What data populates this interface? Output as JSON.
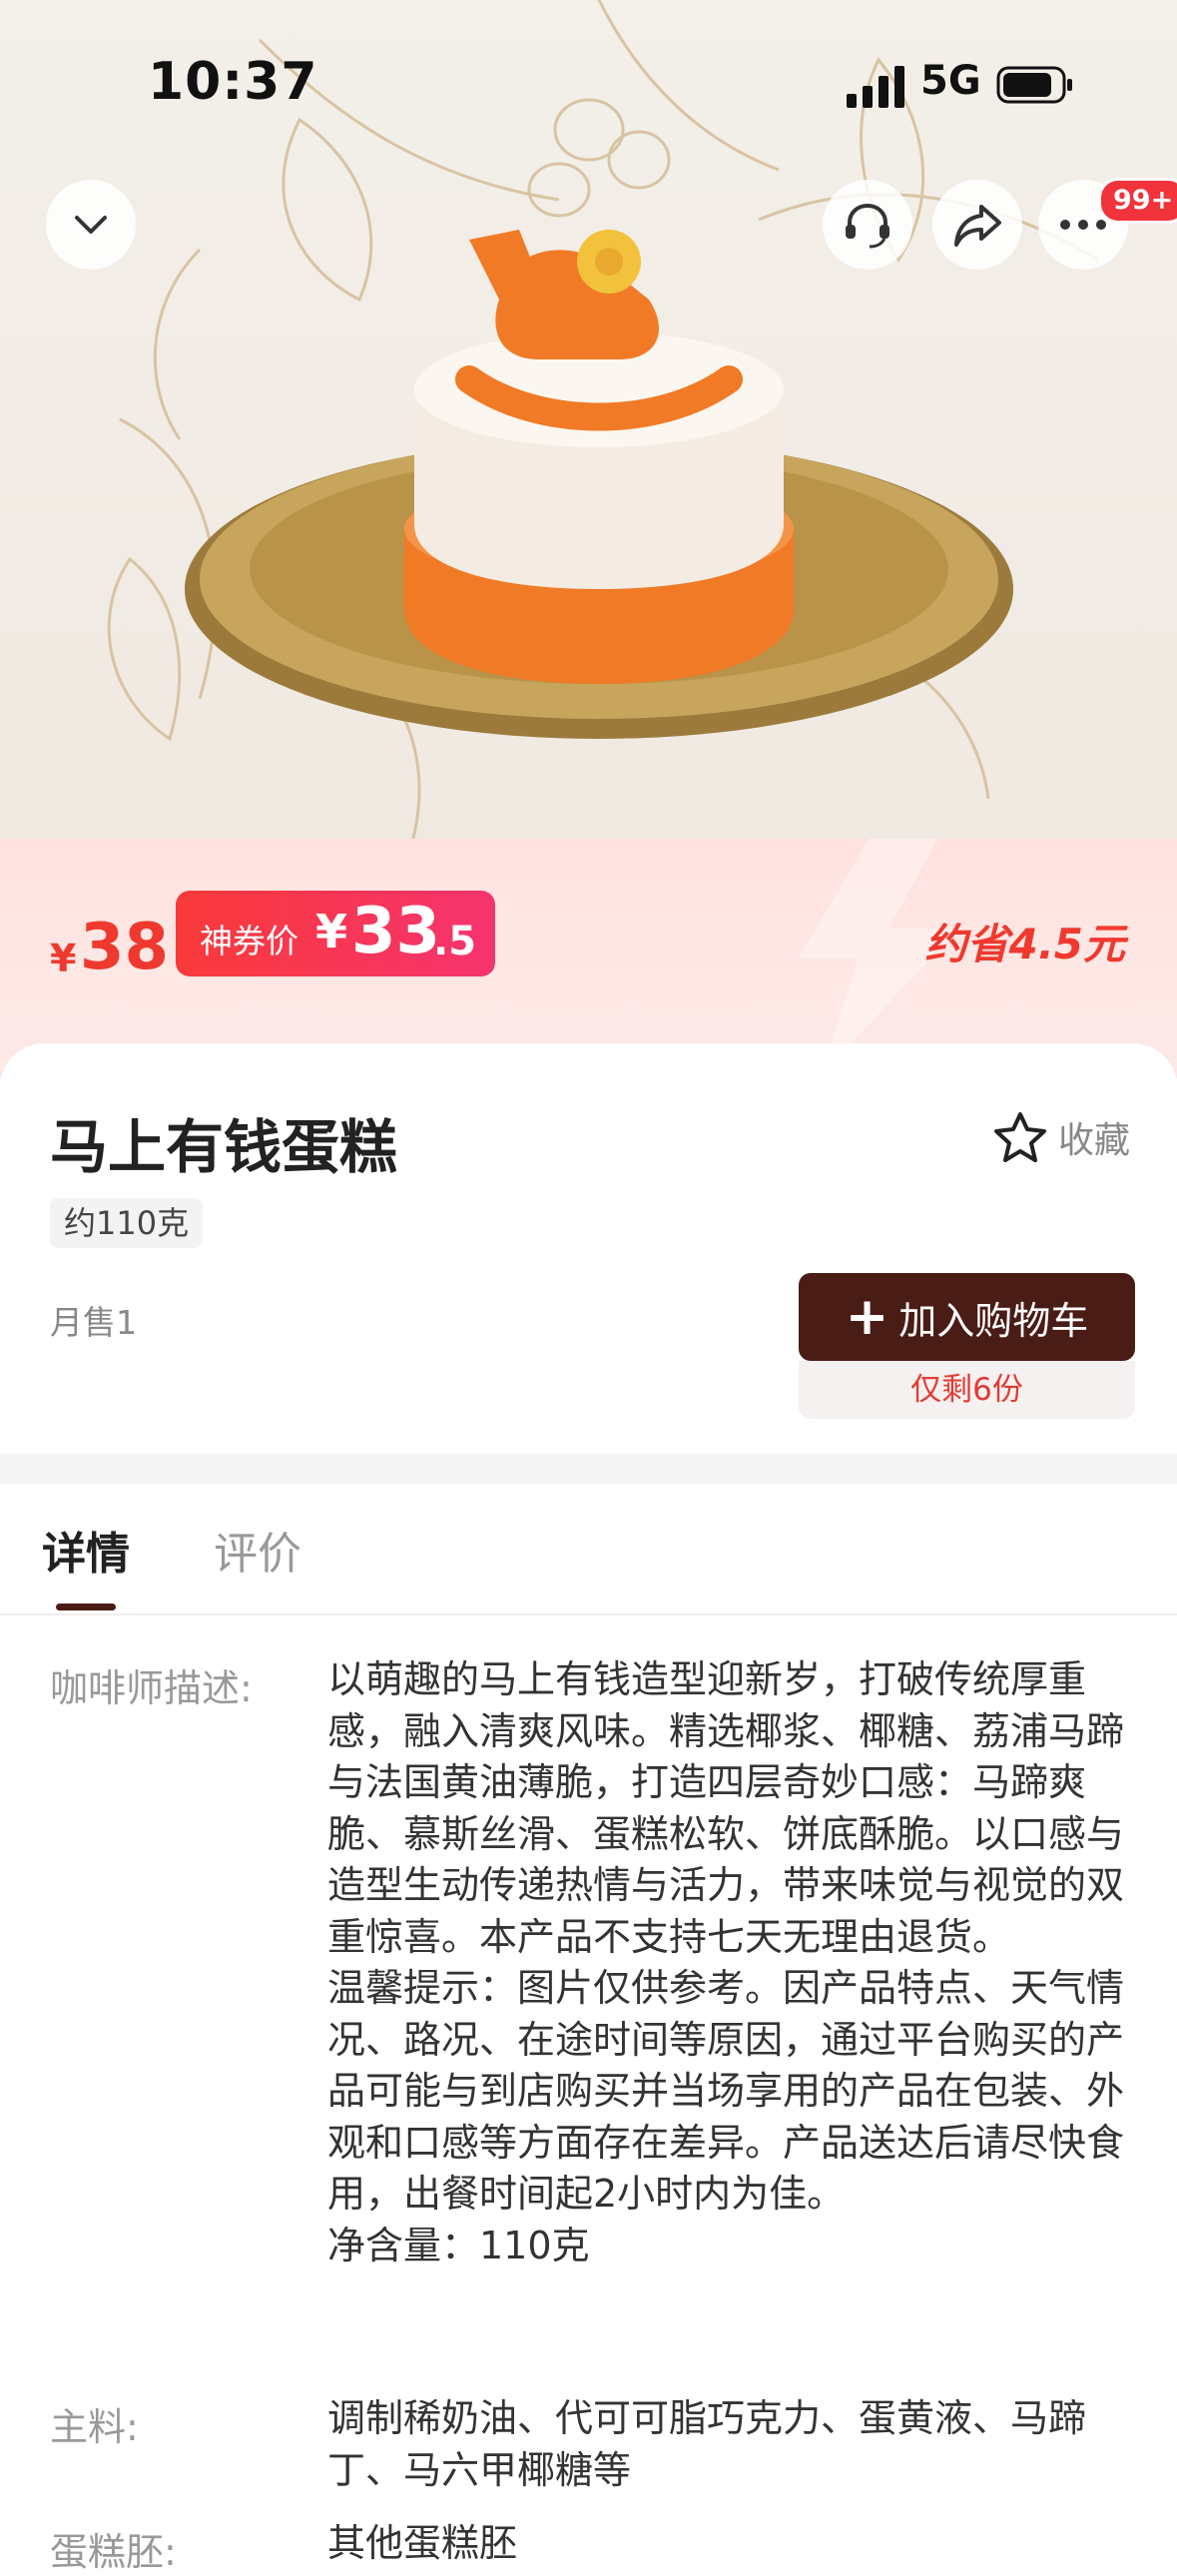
{
  "status_bar": {
    "time": "10:37",
    "network": "5G"
  },
  "top_nav": {
    "badge": "99+"
  },
  "price": {
    "currency": "¥",
    "original": "38",
    "coupon_label": "神券价",
    "coupon_currency": "¥",
    "coupon_int": "33",
    "coupon_dec": ".5",
    "savings": "约省4.5元"
  },
  "product": {
    "name": "马上有钱蛋糕",
    "favorite_label": "收藏",
    "weight": "约110克",
    "monthly_sales": "月售1",
    "add_to_cart": "加入购物车",
    "stock": "仅剩6份"
  },
  "tabs": [
    {
      "label": "详情"
    },
    {
      "label": "评价"
    }
  ],
  "details": [
    {
      "label": "咖啡师描述:",
      "value": "以萌趣的马上有钱造型迎新岁，打破传统厚重感，融入清爽风味。精选椰浆、椰糖、荔浦马蹄与法国黄油薄脆，打造四层奇妙口感：马蹄爽脆、慕斯丝滑、蛋糕松软、饼底酥脆。以口感与造型生动传递热情与活力，带来味觉与视觉的双重惊喜。本产品不支持七天无理由退货。\n温馨提示：图片仅供参考。因产品特点、天气情况、路况、在途时间等原因，通过平台购买的产品可能与到店购买并当场享用的产品在包装、外观和口感等方面存在差异。产品送达后请尽快食用，出餐时间起2小时内为佳。\n净含量：110克"
    },
    {
      "label": "主料:",
      "value": "调制稀奶油、代可可脂巧克力、蛋黄液、马蹄丁、马六甲椰糖等"
    },
    {
      "label": "蛋糕胚:",
      "value": "其他蛋糕胚"
    }
  ],
  "colors": {
    "accent": "#f0392e",
    "button": "#4a1c16"
  }
}
